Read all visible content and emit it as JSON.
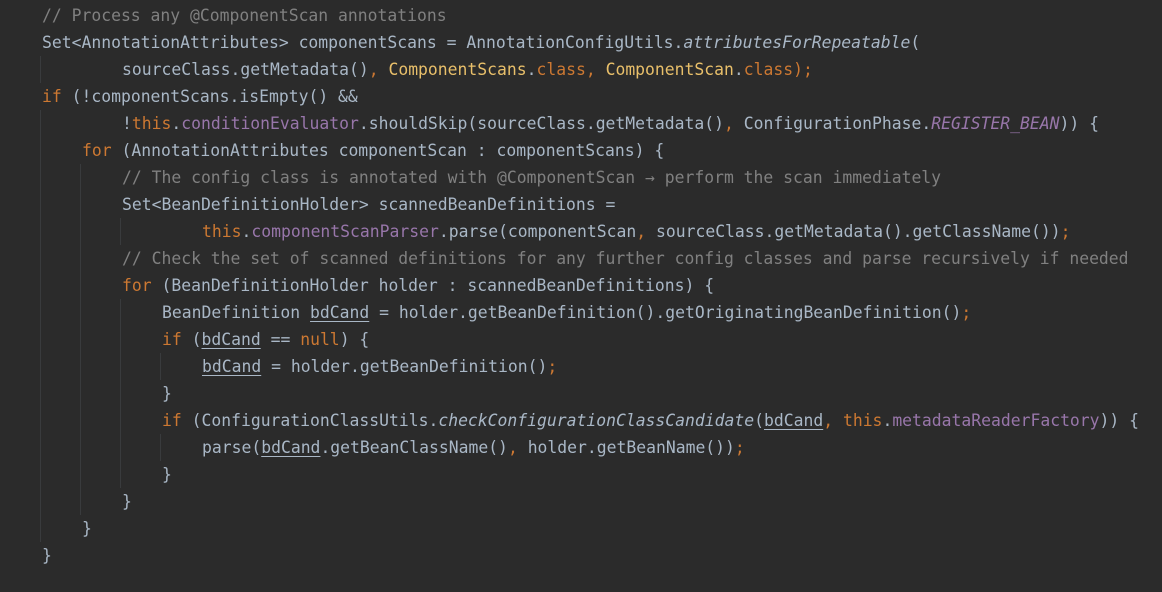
{
  "editor": {
    "lines": [
      {
        "indent": 0,
        "tokens": [
          {
            "t": "// Process any @ComponentScan annotations",
            "c": "comment"
          }
        ]
      },
      {
        "indent": 0,
        "tokens": [
          {
            "t": "Set<AnnotationAttributes> componentScans = AnnotationConfigUtils.",
            "c": "plain"
          },
          {
            "t": "attributesForRepeatable",
            "c": "italicmethod"
          },
          {
            "t": "(",
            "c": "plain"
          }
        ]
      },
      {
        "indent": 2,
        "tokens": [
          {
            "t": "sourceClass.getMetadata()",
            "c": "plain"
          },
          {
            "t": ", ",
            "c": "punct"
          },
          {
            "t": "ComponentScans",
            "c": "yellow"
          },
          {
            "t": ".",
            "c": "plain"
          },
          {
            "t": "class",
            "c": "keyword"
          },
          {
            "t": ", ",
            "c": "punct"
          },
          {
            "t": "ComponentScan",
            "c": "yellow"
          },
          {
            "t": ".",
            "c": "plain"
          },
          {
            "t": "class",
            "c": "keyword"
          },
          {
            "t": ");",
            "c": "punct"
          }
        ]
      },
      {
        "indent": 0,
        "tokens": [
          {
            "t": "if",
            "c": "keyword"
          },
          {
            "t": " (!componentScans.isEmpty() &&",
            "c": "plain"
          }
        ]
      },
      {
        "indent": 2,
        "tokens": [
          {
            "t": "!",
            "c": "plain"
          },
          {
            "t": "this",
            "c": "keyword"
          },
          {
            "t": ".",
            "c": "plain"
          },
          {
            "t": "conditionEvaluator",
            "c": "field"
          },
          {
            "t": ".shouldSkip(sourceClass.getMetadata()",
            "c": "plain"
          },
          {
            "t": ", ",
            "c": "punct"
          },
          {
            "t": "ConfigurationPhase.",
            "c": "plain"
          },
          {
            "t": "REGISTER_BEAN",
            "c": "staticfield"
          },
          {
            "t": ")) {",
            "c": "plain"
          }
        ]
      },
      {
        "indent": 1,
        "tokens": [
          {
            "t": "for",
            "c": "keyword"
          },
          {
            "t": " (AnnotationAttributes componentScan : componentScans) {",
            "c": "plain"
          }
        ]
      },
      {
        "indent": 2,
        "tokens": [
          {
            "t": "// The config class is annotated with @ComponentScan → perform the scan immediately",
            "c": "comment"
          }
        ]
      },
      {
        "indent": 2,
        "tokens": [
          {
            "t": "Set<BeanDefinitionHolder> scannedBeanDefinitions =",
            "c": "plain"
          }
        ]
      },
      {
        "indent": 4,
        "tokens": [
          {
            "t": "this",
            "c": "keyword"
          },
          {
            "t": ".",
            "c": "plain"
          },
          {
            "t": "componentScanParser",
            "c": "field"
          },
          {
            "t": ".parse(componentScan",
            "c": "plain"
          },
          {
            "t": ", ",
            "c": "punct"
          },
          {
            "t": "sourceClass.getMetadata().getClassName())",
            "c": "plain"
          },
          {
            "t": ";",
            "c": "punct"
          }
        ]
      },
      {
        "indent": 2,
        "tokens": [
          {
            "t": "// Check the set of scanned definitions for any further config classes and parse recursively if needed",
            "c": "comment"
          }
        ]
      },
      {
        "indent": 2,
        "tokens": [
          {
            "t": "for",
            "c": "keyword"
          },
          {
            "t": " (BeanDefinitionHolder holder : scannedBeanDefinitions) {",
            "c": "plain"
          }
        ]
      },
      {
        "indent": 3,
        "tokens": [
          {
            "t": "BeanDefinition ",
            "c": "plain"
          },
          {
            "t": "bdCand",
            "c": "ulvar"
          },
          {
            "t": " = holder.getBeanDefinition().getOriginatingBeanDefinition()",
            "c": "plain"
          },
          {
            "t": ";",
            "c": "punct"
          }
        ]
      },
      {
        "indent": 3,
        "tokens": [
          {
            "t": "if",
            "c": "keyword"
          },
          {
            "t": " (",
            "c": "plain"
          },
          {
            "t": "bdCand",
            "c": "ulvar"
          },
          {
            "t": " == ",
            "c": "plain"
          },
          {
            "t": "null",
            "c": "keyword"
          },
          {
            "t": ") {",
            "c": "plain"
          }
        ]
      },
      {
        "indent": 4,
        "tokens": [
          {
            "t": "bdCand",
            "c": "ulvar"
          },
          {
            "t": " = holder.getBeanDefinition()",
            "c": "plain"
          },
          {
            "t": ";",
            "c": "punct"
          }
        ]
      },
      {
        "indent": 3,
        "tokens": [
          {
            "t": "}",
            "c": "plain"
          }
        ]
      },
      {
        "indent": 3,
        "tokens": [
          {
            "t": "if",
            "c": "keyword"
          },
          {
            "t": " (ConfigurationClassUtils.",
            "c": "plain"
          },
          {
            "t": "checkConfigurationClassCandidate",
            "c": "italicmethod"
          },
          {
            "t": "(",
            "c": "plain"
          },
          {
            "t": "bdCand",
            "c": "ulvar"
          },
          {
            "t": ", ",
            "c": "punct"
          },
          {
            "t": "this",
            "c": "keyword"
          },
          {
            "t": ".",
            "c": "plain"
          },
          {
            "t": "metadataReaderFactory",
            "c": "field"
          },
          {
            "t": ")) {",
            "c": "plain"
          }
        ]
      },
      {
        "indent": 4,
        "tokens": [
          {
            "t": "parse(",
            "c": "plain"
          },
          {
            "t": "bdCand",
            "c": "ulvar"
          },
          {
            "t": ".getBeanClassName()",
            "c": "plain"
          },
          {
            "t": ", ",
            "c": "punct"
          },
          {
            "t": "holder.getBeanName())",
            "c": "plain"
          },
          {
            "t": ";",
            "c": "punct"
          }
        ]
      },
      {
        "indent": 3,
        "tokens": [
          {
            "t": "}",
            "c": "plain"
          }
        ]
      },
      {
        "indent": 2,
        "tokens": [
          {
            "t": "}",
            "c": "plain"
          }
        ]
      },
      {
        "indent": 1,
        "tokens": [
          {
            "t": "}",
            "c": "plain"
          }
        ]
      },
      {
        "indent": 0,
        "tokens": [
          {
            "t": "}",
            "c": "plain"
          }
        ]
      }
    ],
    "guides": [
      [],
      [],
      [
        1
      ],
      [],
      [
        1
      ],
      [
        1
      ],
      [
        1,
        2
      ],
      [
        1,
        2
      ],
      [
        1,
        2,
        3
      ],
      [
        1,
        2
      ],
      [
        1,
        2
      ],
      [
        1,
        2,
        3
      ],
      [
        1,
        2,
        3
      ],
      [
        1,
        2,
        3,
        4
      ],
      [
        1,
        2,
        3
      ],
      [
        1,
        2,
        3
      ],
      [
        1,
        2,
        3,
        4
      ],
      [
        1,
        2,
        3
      ],
      [
        1,
        2
      ],
      [
        1
      ],
      []
    ],
    "colors": {
      "background": "#2b2b2b",
      "plain": "#a9b7c6",
      "comment": "#808080",
      "keyword": "#cc7832",
      "field": "#9876aa",
      "type_literal": "#e8bf6a",
      "indent_guide": "#393b3d"
    }
  }
}
